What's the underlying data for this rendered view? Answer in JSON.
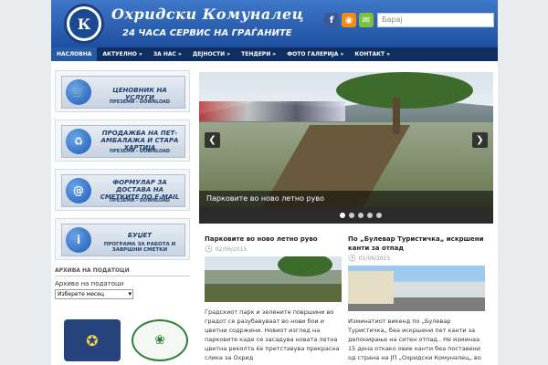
{
  "header": {
    "logo_text": "К",
    "title": "Охридски Комуналец",
    "tagline": "24 ЧАСА СЕРВИС НА ГРАЃАНИТЕ",
    "social": {
      "facebook": "f",
      "rss": "◉",
      "mail": "✉"
    },
    "search_placeholder": "Барај"
  },
  "nav": [
    {
      "label": "НАСЛОВНА"
    },
    {
      "label": "АКТУЕЛНО »"
    },
    {
      "label": "ЗА НАС »"
    },
    {
      "label": "ДЕЈНОСТИ »"
    },
    {
      "label": "ТЕНДЕРИ »"
    },
    {
      "label": "ФОТО ГАЛЕРИЈА »"
    },
    {
      "label": "КОНТАКТ »"
    }
  ],
  "sidebar": {
    "banners": [
      {
        "icon": "🛒",
        "title": "ЦЕНОВНИК НА УСЛУГИ",
        "sub": "ПРЕЗЕМИ - DOWNLOAD"
      },
      {
        "icon": "♻",
        "title": "ПРОДАЖБА НА ПЕТ-АМБАЛАЖА И СТАРА ХАРТИЈА",
        "sub": "ПРЕЗЕМИ - DOWNLOAD"
      },
      {
        "icon": "@",
        "title": "ФОРМУЛАР ЗА ДОСТАВА НА СМЕТКИТЕ ПО E-MAIL",
        "sub": "ПРЕЗЕМИ - DOWNLOAD"
      },
      {
        "icon": "i",
        "title": "БУЏЕТ",
        "sub": "ПРОГРАМА ЗА РАБОТА И ЗАВРШНИ СМЕТКИ"
      }
    ],
    "archive_heading": "АРХИВА НА ПОДАТОЦИ",
    "archive_label": "Архива на податоци",
    "archive_select": "Изберете месец"
  },
  "slider": {
    "caption": "Парковите во ново летно руво",
    "dots": 5,
    "active_dot": 0
  },
  "posts": [
    {
      "title": "Парковите во ново летно руво",
      "date": "02/06/2015",
      "text": "Градскиот парк и зелените површини во градот се разубавуваат во нови бои и цветни содржини. Новиот изглед на парковите каде се засадува новата летна цветна реколта ќе претставува прекрасна слика за Охрид"
    },
    {
      "title": "По „Булевар Туристичка„ искршени канти за отпад",
      "date": "01/06/2015",
      "text": "Изминатиот викенд по „Булевар Туристичка„ беа искршени пет канти за депонирање на ситен отпад.. Не изминаа 15 дена откако овие канти беа поставени од страна на ЈП „Охридски Комуналец„ во"
    }
  ]
}
